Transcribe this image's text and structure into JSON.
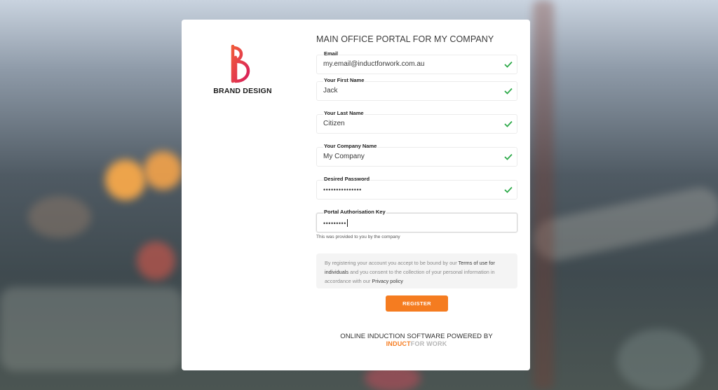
{
  "brand": {
    "name": "BRAND DESIGN",
    "accent": "#e0303d",
    "accent_alt": "#f57c20"
  },
  "form": {
    "title": "MAIN OFFICE PORTAL FOR MY COMPANY",
    "fields": [
      {
        "label": "Email",
        "value": "my.email@inductforwork.com.au",
        "valid": true
      },
      {
        "label": "Your First Name",
        "value": "Jack",
        "valid": true
      },
      {
        "label": "Your Last Name",
        "value": "Citizen",
        "valid": true
      },
      {
        "label": "Your Company Name",
        "value": "My Company",
        "valid": true
      },
      {
        "label": "Desired Password",
        "value": "•••••••••••••••",
        "valid": true
      },
      {
        "label": "Portal Authorisation Key",
        "value": "•••••••••",
        "valid": false
      }
    ],
    "hint": "This was provided to you by the company",
    "notice": {
      "p1": "By registering your account you accept to be bound by our ",
      "terms_link": "Terms of use for individuals",
      "p2": " and you consent to the collection of your personal information in accordance with our ",
      "privacy_link": "Privacy policy"
    },
    "register_label": "REGISTER"
  },
  "footer": {
    "powered_by": "ONLINE INDUCTION SOFTWARE POWERED BY",
    "logo_part1": "INDUCT",
    "logo_part2": "FOR WORK"
  },
  "colors": {
    "check": "#2eaa4a",
    "button": "#f57c20",
    "card": "#ffffff"
  },
  "icons": {
    "valid": "check-icon"
  }
}
